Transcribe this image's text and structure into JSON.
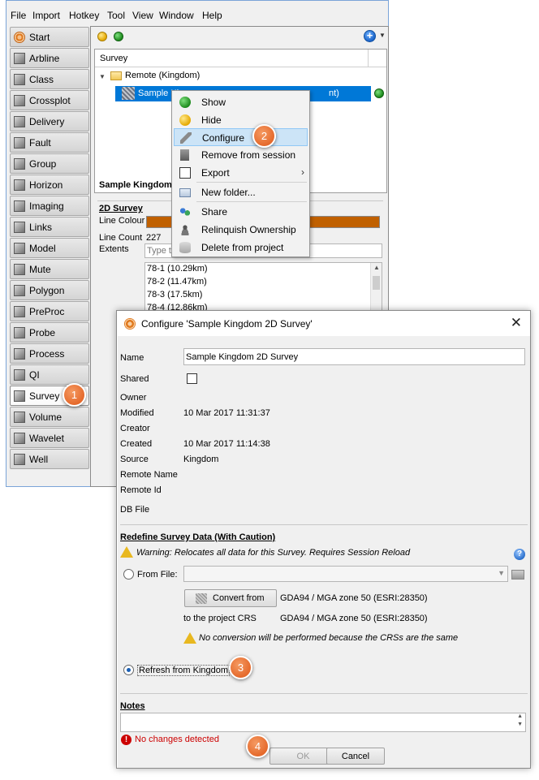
{
  "menubar": [
    "File",
    "Import",
    "Hotkey",
    "Tool",
    "View",
    "Window",
    "Help"
  ],
  "sidebar": {
    "items": [
      {
        "label": "Start",
        "icon": "start-icon"
      },
      {
        "label": "Arbline",
        "icon": "arbline-icon"
      },
      {
        "label": "Class",
        "icon": "class-icon"
      },
      {
        "label": "Crossplot",
        "icon": "crossplot-icon"
      },
      {
        "label": "Delivery",
        "icon": "delivery-icon"
      },
      {
        "label": "Fault",
        "icon": "fault-icon"
      },
      {
        "label": "Group",
        "icon": "group-icon"
      },
      {
        "label": "Horizon",
        "icon": "horizon-icon"
      },
      {
        "label": "Imaging",
        "icon": "imaging-icon"
      },
      {
        "label": "Links",
        "icon": "links-icon"
      },
      {
        "label": "Model",
        "icon": "model-icon"
      },
      {
        "label": "Mute",
        "icon": "mute-icon"
      },
      {
        "label": "Polygon",
        "icon": "polygon-icon"
      },
      {
        "label": "PreProc",
        "icon": "preproc-icon"
      },
      {
        "label": "Probe",
        "icon": "probe-icon"
      },
      {
        "label": "Process",
        "icon": "process-icon"
      },
      {
        "label": "QI",
        "icon": "qi-icon"
      },
      {
        "label": "Survey",
        "icon": "survey-icon",
        "active": true
      },
      {
        "label": "Volume",
        "icon": "volume-icon"
      },
      {
        "label": "Wavelet",
        "icon": "wavelet-icon"
      },
      {
        "label": "Well",
        "icon": "well-icon"
      }
    ]
  },
  "tree": {
    "column_header": "Survey",
    "folder_label": "Remote (Kingdom)",
    "selected_item": "Sample Kin",
    "selected_item_tail": "nt)"
  },
  "detail": {
    "title": "Sample Kingdom",
    "section": "2D Survey",
    "line_colour_label": "Line Colour",
    "line_colour": "#c06000",
    "line_count_label": "Line Count",
    "line_count": "227",
    "extents_label": "Extents",
    "filter_placeholder": "Type to",
    "lines": [
      "78-1 (10.29km)",
      "78-2 (11.47km)",
      "78-3 (17.5km)",
      "78-4 (12.86km)"
    ]
  },
  "context_menu": {
    "items": [
      {
        "label": "Show",
        "icon": "green-dot-icon"
      },
      {
        "label": "Hide",
        "icon": "yellow-dot-icon"
      },
      {
        "label": "Configure",
        "icon": "wrench-icon",
        "highlighted": true
      },
      {
        "label": "Remove from session",
        "icon": "trash-icon"
      },
      {
        "label": "Export",
        "icon": "export-icon",
        "submenu": true
      },
      {
        "label": "New folder...",
        "icon": "folder-icon"
      },
      {
        "label": "Share",
        "icon": "share-icon"
      },
      {
        "label": "Relinquish Ownership",
        "icon": "person-icon"
      },
      {
        "label": "Delete from project",
        "icon": "database-delete-icon"
      }
    ]
  },
  "dialog": {
    "title": "Configure 'Sample Kingdom 2D Survey'",
    "name_label": "Name",
    "name_value": "Sample Kingdom 2D Survey",
    "shared_label": "Shared",
    "owner_label": "Owner",
    "modified_label": "Modified",
    "modified_value": "10 Mar 2017 11:31:37",
    "creator_label": "Creator",
    "created_label": "Created",
    "created_value": "10 Mar 2017 11:14:38",
    "source_label": "Source",
    "source_value": "Kingdom",
    "remote_name_label": "Remote Name",
    "remote_id_label": "Remote Id",
    "db_file_label": "DB File",
    "redefine_title": "Redefine Survey Data (With Caution)",
    "redefine_warning": "Warning: Relocates all data for this Survey. Requires Session Reload",
    "from_file_label": "From File:",
    "convert_from_label": "Convert from",
    "convert_from_crs": "GDA94 / MGA zone 50 (ESRI:28350)",
    "to_project_label": "to the project CRS",
    "project_crs": "GDA94 / MGA zone 50 (ESRI:28350)",
    "no_conversion_note": "No conversion will be performed because the CRSs are the same",
    "refresh_label": "Refresh from Kingdom",
    "notes_title": "Notes",
    "status_text": "No changes detected",
    "ok_label": "OK",
    "cancel_label": "Cancel"
  },
  "callouts": [
    "1",
    "2",
    "3",
    "4"
  ],
  "colors": {
    "selection": "#0078d7",
    "menu_highlight": "#cce4f7",
    "callout": "#e56a2c",
    "error": "#cc0000",
    "warning": "#e8b820"
  }
}
